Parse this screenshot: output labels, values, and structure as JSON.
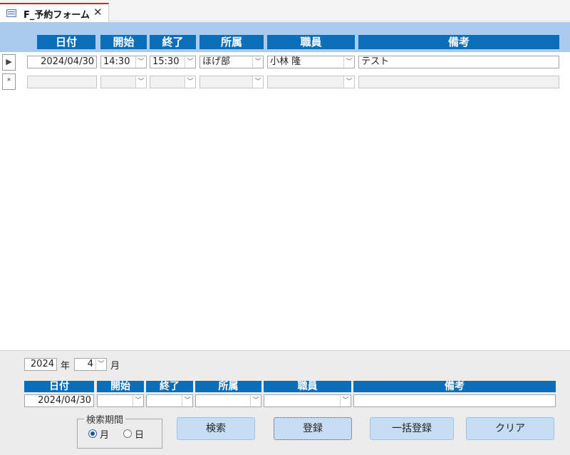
{
  "tab": {
    "title": "F_予約フォーム",
    "close": "✕",
    "icon": "form-icon"
  },
  "columns": {
    "date": "日付",
    "start": "開始",
    "end": "終了",
    "dept": "所属",
    "staff": "職員",
    "notes": "備考"
  },
  "records": [
    {
      "selector": "▶",
      "date": "2024/04/30",
      "start": "14:30",
      "end": "15:30",
      "dept": "ほげ部",
      "staff": "小林 隆",
      "notes": "テスト"
    },
    {
      "selector": "*",
      "date": "",
      "start": "",
      "end": "",
      "dept": "",
      "staff": "",
      "notes": ""
    }
  ],
  "footer": {
    "year_value": "2024",
    "year_label": "年",
    "month_value": "4",
    "month_label": "月",
    "new_row": {
      "date": "2024/04/30",
      "start": "",
      "end": "",
      "dept": "",
      "staff": "",
      "notes": ""
    },
    "search_period": {
      "label": "検索期間",
      "option_month": "月",
      "option_day": "日",
      "selected": "月"
    },
    "buttons": {
      "search": "検索",
      "register": "登録",
      "bulk_register": "一括登録",
      "clear": "クリア"
    }
  },
  "colors": {
    "header_band": "#a9cbed",
    "column_header": "#0a6fb8",
    "tab_accent": "#b9323a",
    "button": "#c7ddf3"
  }
}
